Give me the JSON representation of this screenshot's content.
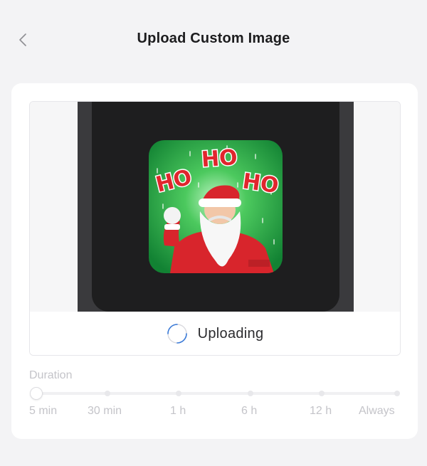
{
  "header": {
    "back_icon": "chevron-left-icon",
    "title": "Upload Custom Image"
  },
  "preview": {
    "image_text": [
      "HO",
      "HO",
      "HO"
    ],
    "image_description_icon": "santa-image"
  },
  "upload": {
    "status_icon": "loading-spinner-icon",
    "status": "Uploading"
  },
  "duration": {
    "label": "Duration",
    "options": [
      "5 min",
      "30 min",
      "1 h",
      "6 h",
      "12 h",
      "Always"
    ],
    "selected": "5 min"
  },
  "colors": {
    "background": "#f3f3f5",
    "card": "#ffffff",
    "spinner": "#3b7bd8",
    "muted_text": "#c4c4c9",
    "image_green": "#1f9a3f",
    "image_red": "#d8252c"
  }
}
